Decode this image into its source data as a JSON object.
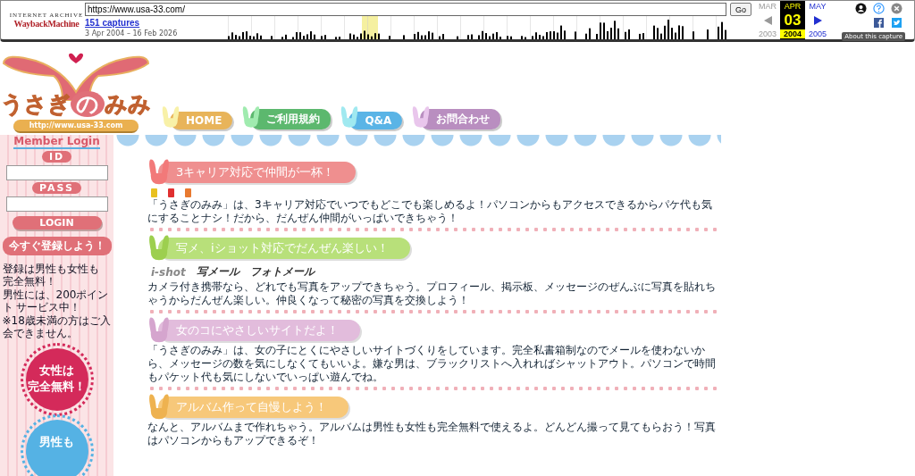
{
  "wayback": {
    "brand_top": "INTERNET ARCHIVE",
    "brand_main": "WaybackMachine",
    "url": "https://www.usa-33.com/",
    "go": "Go",
    "captures": "151 captures",
    "range": "3 Apr 2004 – 16 Feb 2026",
    "months": [
      {
        "month": "MAR",
        "year": "2003",
        "selected": false
      },
      {
        "month": "APR",
        "day": "03",
        "year": "2004",
        "selected": true
      },
      {
        "month": "MAY",
        "year": "2005",
        "selected": false
      }
    ],
    "about": "About this capture"
  },
  "logo": {
    "title_parts": [
      "うさぎ",
      "の",
      "みみ"
    ],
    "url": "http://www.usa-33.com"
  },
  "nav": [
    {
      "label": "HOME",
      "color": "#e8b45a"
    },
    {
      "label": "ご利用規約",
      "color": "#5cb86e"
    },
    {
      "label": "Q&A",
      "color": "#5ab4e6"
    },
    {
      "label": "お問合わせ",
      "color": "#b98ec0"
    }
  ],
  "sidebar": {
    "heading": "Member Login",
    "id_label": "ID",
    "pass_label": "PASS",
    "login": "LOGIN",
    "register": "今すぐ登録しよう！",
    "notice": [
      "登録は男性も女性も",
      "完全無料！",
      "男性には、200ポイント サービス中！",
      "※18歳未満の方はご入会できません。"
    ],
    "badges": [
      {
        "lines": [
          "女性は",
          "完全無料！"
        ],
        "color": "#d42a5a"
      },
      {
        "lines": [
          "男性も"
        ],
        "color": "#55b2e4"
      }
    ]
  },
  "sections": [
    {
      "title": "3キャリア対応で仲間が一杯！",
      "color": "#ef8f8f",
      "icons": [
        {
          "color": "#e8c020"
        },
        {
          "color": "#e03030"
        },
        {
          "color": "#e87a30"
        }
      ],
      "body": "「うさぎのみみ」は、3キャリア対応でいつでもどこでも楽しめるよ！パソコンからもアクセスできるからパケ代も気にすることナシ！だから、だんぜん仲間がいっぱいできちゃう！"
    },
    {
      "title": "写メ、iショット対応でだんぜん楽しい！",
      "color": "#b8e07a",
      "logos": [
        "i-shot",
        "写メール",
        "フォトメール"
      ],
      "body": "カメラ付き携帯なら、どれでも写真をアップできちゃう。プロフィール、掲示板、メッセージのぜんぶに写真を貼れちゃうからだんぜん楽しい。仲良くなって秘密の写真を交換しよう！"
    },
    {
      "title": "女のコにやさしいサイトだよ！",
      "color": "#e2bcdc",
      "body": "「うさぎのみみ」は、女の子にとくにやさしいサイトづくりをしています。完全私書箱制なのでメールを使わないから、メッセージの数を気にしなくてもいいよ。嫌な男は、ブラックリストへ入れればシャットアウト。パソコンで時間もパケット代も気にしないでいっぱい遊んでね。"
    },
    {
      "title": "アルバム作って自慢しよう！",
      "color": "#f7c87a",
      "body": "なんと、アルバムまで作れちゃう。アルバムは男性も女性も完全無料で使えるよ。どんどん撮って見てもらおう！写真はパソコンからもアップできるぞ！"
    }
  ]
}
